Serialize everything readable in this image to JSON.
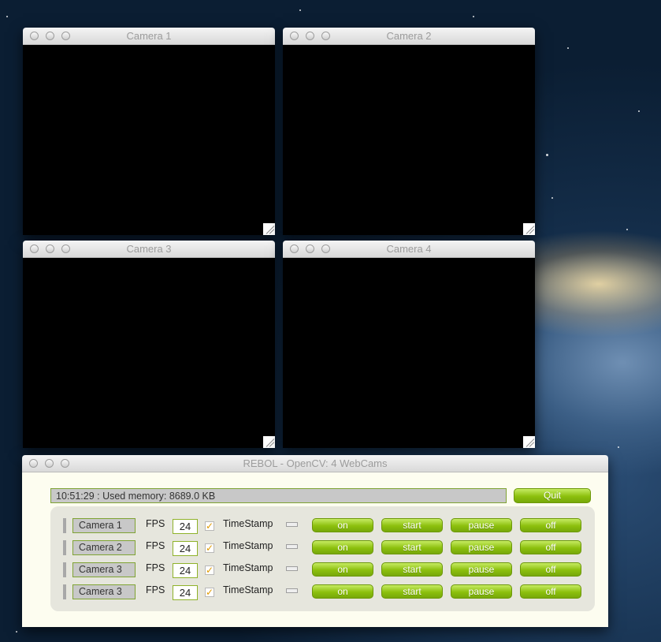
{
  "camera_windows": [
    {
      "title": "Camera 1"
    },
    {
      "title": "Camera 2"
    },
    {
      "title": "Camera 3"
    },
    {
      "title": "Camera 4"
    }
  ],
  "control_window": {
    "title": "REBOL - OpenCV: 4 WebCams",
    "status_text": "10:51:29 : Used memory: 8689.0 KB",
    "quit_label": "Quit",
    "fps_label": "FPS",
    "timestamp_label": "TimeStamp",
    "buttons": {
      "on": "on",
      "start": "start",
      "pause": "pause",
      "off": "off"
    },
    "rows": [
      {
        "camera": "Camera 1",
        "fps": "24",
        "timestamp_checked": "✓"
      },
      {
        "camera": "Camera 2",
        "fps": "24",
        "timestamp_checked": "✓"
      },
      {
        "camera": "Camera 3",
        "fps": "24",
        "timestamp_checked": "✓"
      },
      {
        "camera": "Camera 3",
        "fps": "24",
        "timestamp_checked": "✓"
      }
    ]
  },
  "colors": {
    "button_green": "#8cc00d",
    "field_border": "#7fa333",
    "video_background": "#000000",
    "check_mark": "#e09a00"
  }
}
